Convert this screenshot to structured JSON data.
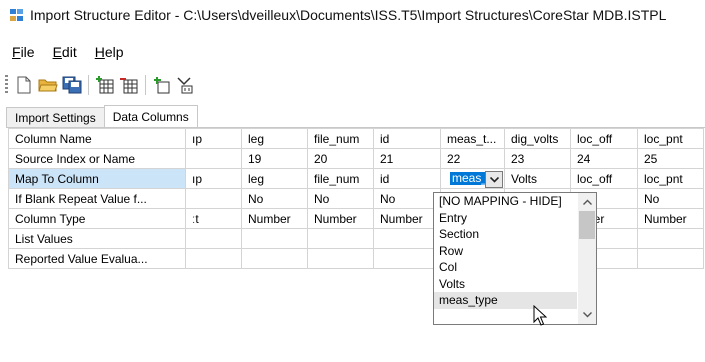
{
  "window": {
    "title": "Import Structure Editor - C:\\Users\\dveilleux\\Documents\\ISS.T5\\Import Structures\\CoreStar MDB.ISTPL"
  },
  "menu": [
    {
      "label": "File",
      "accel": "F",
      "rest": "ile"
    },
    {
      "label": "Edit",
      "accel": "E",
      "rest": "dit"
    },
    {
      "label": "Help",
      "accel": "H",
      "rest": "elp"
    }
  ],
  "toolbar": {
    "buttons": [
      "new-icon",
      "open-icon",
      "save-icon",
      "add-column-icon",
      "remove-column-icon",
      "insert-icon",
      "mapping-icon"
    ]
  },
  "tabs": [
    {
      "label": "Import Settings",
      "active": false
    },
    {
      "label": "Data Columns",
      "active": true
    }
  ],
  "grid": {
    "row_headers": [
      "Column Name",
      "Source Index or Name",
      "Map To Column",
      "If Blank Repeat Value f...",
      "Column Type",
      "List Values",
      "Reported Value Evalua..."
    ],
    "columns": [
      {
        "cells": [
          "ıp",
          "",
          "ıp",
          "",
          "ːt",
          "",
          ""
        ]
      },
      {
        "cells": [
          "leg",
          "19",
          "leg",
          "No",
          "Number",
          "",
          ""
        ]
      },
      {
        "cells": [
          "file_num",
          "20",
          "file_num",
          "No",
          "Number",
          "",
          ""
        ]
      },
      {
        "cells": [
          "id",
          "21",
          "id",
          "No",
          "Number",
          "",
          ""
        ]
      },
      {
        "cells": [
          "meas_t...",
          "22",
          "",
          "",
          "",
          "",
          ""
        ]
      },
      {
        "cells": [
          "dig_volts",
          "23",
          "Volts",
          "",
          "",
          "",
          ""
        ]
      },
      {
        "cells": [
          "loc_off",
          "24",
          "loc_off",
          "",
          "mber",
          "",
          ""
        ]
      },
      {
        "cells": [
          "loc_pnt",
          "25",
          "loc_pnt",
          "No",
          "Number",
          "",
          ""
        ]
      }
    ],
    "active_cell_value": "meas_"
  },
  "dropdown": {
    "options": [
      "[NO MAPPING - HIDE]",
      "Entry",
      "Section",
      "Row",
      "Col",
      "Volts",
      "meas_type"
    ],
    "highlighted": "meas_type"
  }
}
